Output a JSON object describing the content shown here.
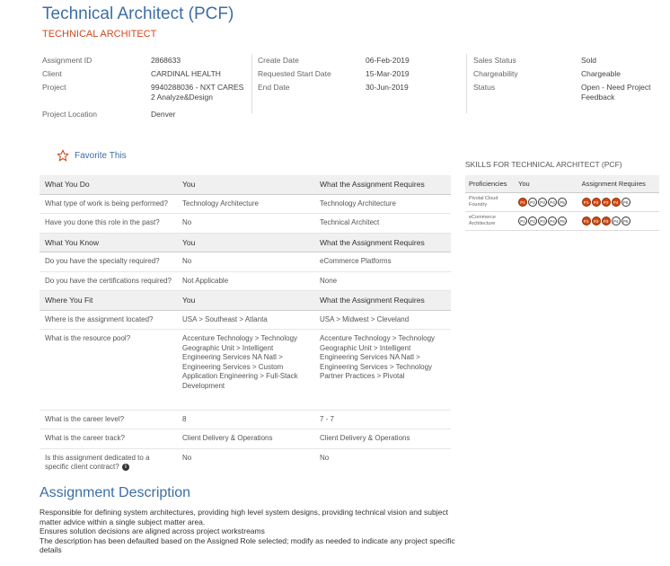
{
  "header": {
    "title": "Technical Architect (PCF)",
    "subtitle": "TECHNICAL ARCHITECT"
  },
  "details": {
    "col1": [
      {
        "label": "Assignment ID",
        "value": "2868633"
      },
      {
        "label": "Client",
        "value": "CARDINAL HEALTH"
      },
      {
        "label": "Project",
        "value": "9940288036 - NXT CARES 2 Analyze&Design"
      },
      {
        "label": "Project Location",
        "value": "Denver"
      }
    ],
    "col2": [
      {
        "label": "Create Date",
        "value": "06-Feb-2019"
      },
      {
        "label": "Requested Start Date",
        "value": "15-Mar-2019"
      },
      {
        "label": "End Date",
        "value": "30-Jun-2019"
      }
    ],
    "col3": [
      {
        "label": "Sales Status",
        "value": "Sold"
      },
      {
        "label": "Chargeability",
        "value": "Chargeable"
      },
      {
        "label": "Status",
        "value": "Open - Need Project Feedback"
      }
    ]
  },
  "favorite": {
    "label": "Favorite This",
    "icon": "star-outline-icon",
    "color": "#d0471f"
  },
  "qa": {
    "know_what": {
      "header": [
        "What You Do",
        "You",
        "What the Assignment Requires"
      ],
      "rows": [
        [
          "What type of work is being performed?",
          "Technology Architecture",
          "Technology Architecture"
        ],
        [
          "Have you done this role in the past?",
          "No",
          "Technical Architect"
        ]
      ]
    },
    "know": {
      "header": [
        "What You Know",
        "You",
        "What the Assignment Requires"
      ],
      "rows": [
        [
          "Do you have the specialty required?",
          "No",
          "eCommerce Platforms"
        ],
        [
          "Do you have the certifications required?",
          "Not Applicable",
          "None"
        ]
      ]
    },
    "fit": {
      "header": [
        "Where You Fit",
        "You",
        "What the Assignment Requires"
      ],
      "rows": [
        [
          "Where is the assignment located?",
          "USA > Southeast > Atlanta",
          "USA > Midwest > Cleveland"
        ],
        [
          "What is the resource pool?",
          "Accenture Technology > Technology Geographic Unit > Intelligent Engineering Services NA Natl > Engineering Services > Custom Application Engineering > Full-Stack Development",
          "Accenture Technology > Technology Geographic Unit > Intelligent Engineering Services NA Natl > Engineering Services > Technology Partner Practices > Pivotal"
        ]
      ],
      "rows2": [
        [
          "What is the career level?",
          "8",
          "7 - 7"
        ],
        [
          "What is the career track?",
          "Client Delivery & Operations",
          "Client Delivery & Operations"
        ],
        [
          "Is this assignment dedicated to a specific client contract?",
          "No",
          "No"
        ]
      ]
    }
  },
  "skills": {
    "title": "SKILLS FOR TECHNICAL ARCHITECT (PCF)",
    "headers": [
      "Proficiencies",
      "You",
      "Assignment Requires"
    ],
    "levels": [
      "P1",
      "P2",
      "P3",
      "P4",
      "P5"
    ],
    "accent": "#d34b12",
    "rows": [
      {
        "name": "Pivotal Cloud Foundry",
        "you_level": 1,
        "required_level": 4
      },
      {
        "name": "eCommerce Architecture",
        "you_level": 0,
        "required_level": 3
      }
    ]
  },
  "description": {
    "title": "Assignment Description",
    "lines": [
      "Responsible for defining system architectures, providing high level system designs, providing technical vision and subject matter advice within a single subject matter area.",
      "Ensures solution decisions are aligned across project workstreams",
      "The description has been defaulted based on the Assigned Role selected; modify as needed to indicate any project specific details"
    ]
  }
}
